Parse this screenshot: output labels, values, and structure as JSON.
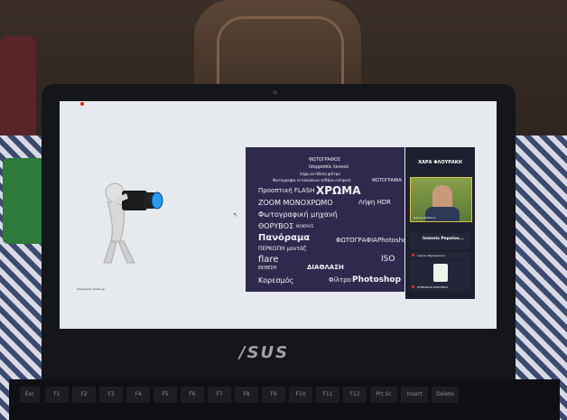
{
  "sidebar": {
    "title": "ΧΑΡΑ ΦΛΟΥΡΑΚΗ",
    "video_name": "Ioannis Sofianos",
    "tiles": [
      {
        "big": "Ioannis Papalos...",
        "small": "ΧΑΡΑ ΦΛΟΥΡΑΚΗ"
      },
      {
        "big": "",
        "small": "Ioannis Papaioannou"
      },
      {
        "big": "",
        "small": "ΣΤΕΦΑΝΟΣ ΚΑΡΑΤΖΙΑΣ"
      }
    ]
  },
  "slide_url": "www.photo-studio.gr",
  "brand": "/SUS",
  "keys": [
    "Esc",
    "F1",
    "F2",
    "F3",
    "F4",
    "F5",
    "F6",
    "F7",
    "F8",
    "F9",
    "F10",
    "F11",
    "F12",
    "Prt Sc",
    "Insert",
    "Delete"
  ],
  "wordcloud": [
    "ΦΩΤΟΓΡΑΦΟΣ",
    "Ισορροπία λευκού",
    "λήψη αντίθεση φίλτρο",
    "Φωτογραφία εντυπώσεων softbox compact",
    "ΦΩΤΟΓΡΑΦΙΑ",
    "Προοπτική FLASH",
    "ΧΡΩΜΑ",
    "Λήψη HDR",
    "ZOOM ΜΟΝΟΧΡΩΜΟ",
    "Φωτογραφική",
    "Φωτογραφική μηχανή",
    "ΘΟΡΥΒΟΣ",
    "Πανόραμα",
    "ΜΑΚΡΟ",
    "ΠΕΡΚΟΠΗ μοντάζ",
    "ΦΩΤΟΓΡΑΦΙΑ",
    "flare",
    "ΔΙΑΦΡΑΓΜΑ",
    "ΔΙΑΘΛΑΣΗ",
    "Κορεσμός",
    "Photoshop",
    "Φίλτρο",
    "ISO",
    "ΕΚΘΕΣΗ",
    "λευκού",
    "MONTAΓΕ"
  ]
}
